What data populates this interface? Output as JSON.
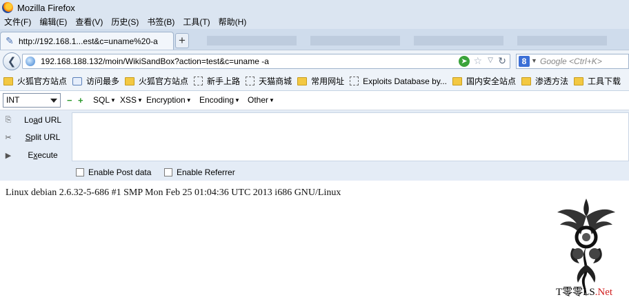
{
  "window": {
    "title": "Mozilla Firefox"
  },
  "menu": [
    "文件(F)",
    "编辑(E)",
    "查看(V)",
    "历史(S)",
    "书签(B)",
    "工具(T)",
    "帮助(H)"
  ],
  "tabs": [
    {
      "label": "http://192.168.1...est&c=uname%20-a",
      "active": true
    }
  ],
  "new_tab_label": "+",
  "urlbar": {
    "value": "192.168.188.132/moin/WikiSandBox?action=test&c=uname -a"
  },
  "search": {
    "engine_glyph": "8",
    "placeholder": "Google <Ctrl+K>"
  },
  "bookmarks": [
    {
      "label": "火狐官方站点",
      "icon": "folder-icon"
    },
    {
      "label": "访问最多",
      "icon": "page-icon"
    },
    {
      "label": "火狐官方站点",
      "icon": "folder-icon"
    },
    {
      "label": "新手上路",
      "icon": "dashed-page-icon"
    },
    {
      "label": "天猫商城",
      "icon": "dashed-page-icon"
    },
    {
      "label": "常用网址",
      "icon": "folder-icon"
    },
    {
      "label": "Exploits Database by...",
      "icon": "dashed-page-icon"
    },
    {
      "label": "国内安全站点",
      "icon": "folder-icon"
    },
    {
      "label": "渗透方法",
      "icon": "folder-icon"
    },
    {
      "label": "工具下载",
      "icon": "folder-icon"
    }
  ],
  "hackbar": {
    "int_select": "INT",
    "minus": "−",
    "plus": "+",
    "menus": [
      "SQL",
      "XSS",
      "Encryption",
      "Encoding",
      "Other"
    ],
    "buttons": [
      {
        "key": "Lo",
        "mn": "a",
        "rest": "d URL"
      },
      {
        "key": "",
        "mn": "S",
        "rest": "plit URL"
      },
      {
        "key": "E",
        "mn": "x",
        "rest": "ecute"
      }
    ],
    "enable_post": "Enable Post data",
    "enable_referrer": "Enable Referrer"
  },
  "page": {
    "output": "Linux debian 2.6.32-5-686 #1 SMP Mon Feb 25 01:04:36 UTC 2013 i686 GNU/Linux"
  },
  "watermark": {
    "prefix": "T零零LS",
    "suffix": ".Net"
  },
  "colors": {
    "chrome": "#dbe5f1",
    "hackbar_panel": "#e4ecf6",
    "go": "#3aa33a",
    "watermark_net": "#d11f1f"
  }
}
